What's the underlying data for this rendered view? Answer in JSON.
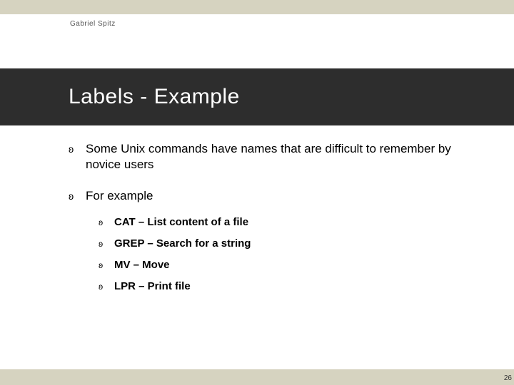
{
  "author": "Gabriel Spitz",
  "title": "Labels - Example",
  "bullets": [
    {
      "text": "Some Unix commands have names that are difficult to remember by novice users"
    },
    {
      "text": "For example",
      "children": [
        {
          "text": "CAT – List content of a file"
        },
        {
          "text": "GREP – Search for a string"
        },
        {
          "text": "MV – Move"
        },
        {
          "text": "LPR – Print file"
        }
      ]
    }
  ],
  "page_number": "26",
  "bullet_glyph": "ʚ"
}
